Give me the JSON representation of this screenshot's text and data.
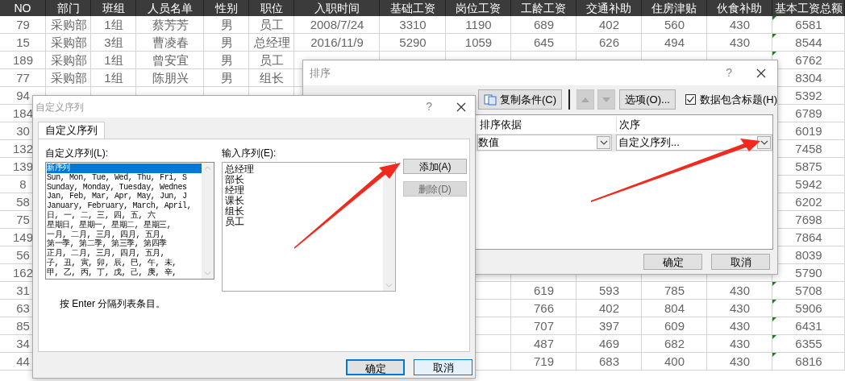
{
  "sheet": {
    "columns": [
      "NO",
      "部门",
      "班组",
      "人员名单",
      "性别",
      "职位",
      "入职时间",
      "基础工资",
      "岗位工资",
      "工龄工资",
      "交通补助",
      "住房津贴",
      "伙食补助",
      "基本工资总额"
    ],
    "rows": [
      {
        "cells": [
          "79",
          "采购部",
          "1组",
          "蔡芳芳",
          "男",
          "员工",
          "2008/7/24",
          "3310",
          "1190",
          "689",
          "402",
          "560",
          "430",
          "6581"
        ]
      },
      {
        "cells": [
          "15",
          "采购部",
          "3组",
          "曹凌春",
          "男",
          "总经理",
          "2016/11/9",
          "5290",
          "1059",
          "645",
          "626",
          "494",
          "430",
          "8544"
        ]
      },
      {
        "cells": [
          "189",
          "采购部",
          "1组",
          "曾安宜",
          "男",
          "员工",
          null,
          null,
          null,
          null,
          null,
          null,
          null,
          "6762"
        ]
      },
      {
        "cells": [
          "77",
          "采购部",
          "1组",
          "陈朋兴",
          "男",
          "组长",
          null,
          null,
          null,
          null,
          null,
          null,
          null,
          "8304"
        ]
      },
      {
        "cells": [
          "94",
          null,
          null,
          null,
          null,
          null,
          null,
          null,
          null,
          null,
          null,
          null,
          null,
          "5392"
        ]
      },
      {
        "cells": [
          "184",
          null,
          null,
          null,
          null,
          null,
          null,
          null,
          null,
          null,
          null,
          null,
          null,
          "6789"
        ]
      },
      {
        "cells": [
          "30",
          null,
          null,
          null,
          null,
          null,
          null,
          null,
          null,
          null,
          null,
          null,
          null,
          "6019"
        ]
      },
      {
        "cells": [
          "132",
          null,
          null,
          null,
          null,
          null,
          null,
          null,
          null,
          null,
          null,
          null,
          null,
          "7458"
        ]
      },
      {
        "cells": [
          "139",
          null,
          null,
          null,
          null,
          null,
          null,
          null,
          null,
          null,
          null,
          null,
          null,
          "5875"
        ]
      },
      {
        "cells": [
          "8",
          null,
          null,
          null,
          null,
          null,
          null,
          null,
          null,
          null,
          null,
          null,
          null,
          "5942"
        ]
      },
      {
        "cells": [
          "58",
          null,
          null,
          null,
          null,
          null,
          null,
          null,
          null,
          null,
          null,
          null,
          null,
          "6202"
        ]
      },
      {
        "cells": [
          "75",
          null,
          null,
          null,
          null,
          null,
          null,
          null,
          null,
          null,
          null,
          null,
          null,
          "7698"
        ]
      },
      {
        "cells": [
          "149",
          null,
          null,
          null,
          null,
          null,
          null,
          null,
          null,
          null,
          null,
          null,
          null,
          "7864"
        ]
      },
      {
        "cells": [
          "56",
          null,
          null,
          null,
          null,
          null,
          null,
          null,
          null,
          null,
          null,
          null,
          null,
          "8039"
        ]
      },
      {
        "cells": [
          "162",
          null,
          null,
          null,
          null,
          null,
          null,
          null,
          null,
          null,
          null,
          null,
          null,
          "5790"
        ]
      },
      {
        "cells": [
          "31",
          null,
          null,
          null,
          null,
          null,
          null,
          null,
          null,
          "619",
          "593",
          "785",
          "430",
          "5708"
        ]
      },
      {
        "cells": [
          "63",
          null,
          null,
          null,
          null,
          null,
          null,
          null,
          null,
          "766",
          "402",
          "804",
          "430",
          "5906"
        ]
      },
      {
        "cells": [
          "85",
          null,
          null,
          null,
          null,
          null,
          null,
          null,
          null,
          "707",
          "397",
          "609",
          "430",
          "6431"
        ]
      },
      {
        "cells": [
          "34",
          null,
          null,
          null,
          null,
          null,
          null,
          null,
          null,
          "487",
          "469",
          "682",
          "430",
          "6355"
        ]
      },
      {
        "cells": [
          "44",
          null,
          null,
          null,
          null,
          null,
          null,
          null,
          null,
          "719",
          "683",
          "400",
          "430",
          "6816"
        ]
      }
    ]
  },
  "sort_dialog": {
    "title": "排序",
    "help": "?",
    "toolbar": [
      {
        "kind": "copy",
        "label": "复制条件(C)",
        "disabled": false
      },
      {
        "kind": "up",
        "disabled": true
      },
      {
        "kind": "down",
        "disabled": true
      },
      {
        "kind": "options",
        "label": "选项(O)...",
        "disabled": false
      }
    ],
    "header_checkbox": {
      "label": "数据包含标题(H)",
      "checked": true
    },
    "grid_headers": [
      "排序依据",
      "次序"
    ],
    "grid_values": [
      "数值",
      "自定义序列..."
    ],
    "ok": "确定",
    "cancel": "取消"
  },
  "custom_list_dialog": {
    "title": "自定义序列",
    "help": "?",
    "tabs": [
      {
        "label": "自定义序列",
        "selected": true
      }
    ],
    "lists_label": "自定义序列(L):",
    "lists": [
      {
        "text": "新序列",
        "selected": true
      },
      {
        "text": "Sun, Mon, Tue, Wed, Thu, Fri, S",
        "selected": false
      },
      {
        "text": "Sunday, Monday, Tuesday, Wednes",
        "selected": false
      },
      {
        "text": "Jan, Feb, Mar, Apr, May, Jun, J",
        "selected": false
      },
      {
        "text": "January, February, March, April,",
        "selected": false
      },
      {
        "text": "日, 一, 二, 三, 四, 五, 六",
        "selected": false
      },
      {
        "text": "星期日, 星期一, 星期二, 星期三,",
        "selected": false
      },
      {
        "text": "一月, 二月, 三月, 四月, 五月,",
        "selected": false
      },
      {
        "text": "第一季, 第二季, 第三季, 第四季",
        "selected": false
      },
      {
        "text": "正月, 二月, 三月, 四月, 五月,",
        "selected": false
      },
      {
        "text": "子, 丑, 寅, 卯, 辰, 巳, 午, 未,",
        "selected": false
      },
      {
        "text": "甲, 乙, 丙, 丁, 戊, 己, 庚, 辛,",
        "selected": false
      }
    ],
    "entries_label": "输入序列(E):",
    "entries": [
      "总经理",
      "部长",
      "经理",
      "课长",
      "组长",
      "员工"
    ],
    "add_button": {
      "label": "添加(A)",
      "disabled": false
    },
    "delete_button": {
      "label": "删除(D)",
      "disabled": true
    },
    "hint": "按 Enter 分隔列表条目。",
    "ok": "确定",
    "cancel": "取消"
  }
}
